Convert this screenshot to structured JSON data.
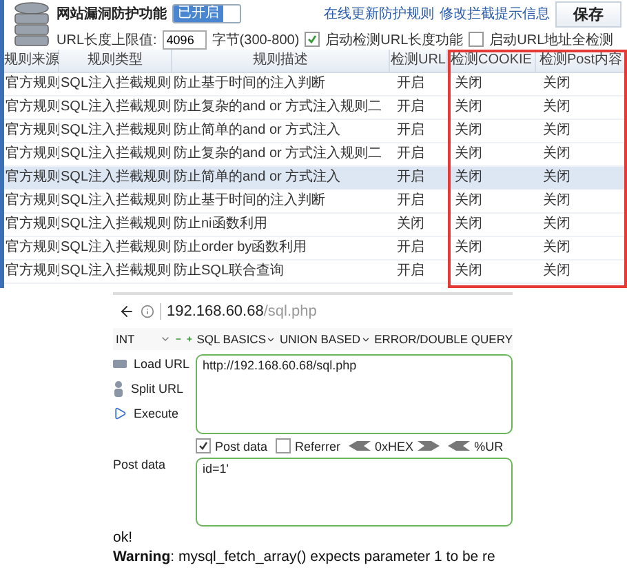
{
  "feature": {
    "title": "网站漏洞防护功能",
    "toggle": {
      "label": "已开启",
      "on": true
    }
  },
  "top_links": [
    "在线更新防护规则",
    "修改拦截提示信息"
  ],
  "save_button": "保存",
  "url_length": {
    "label": "URL长度上限值:",
    "value": "4096",
    "unit": "字节(300-800)"
  },
  "options": [
    {
      "label": "启动检测URL长度功能",
      "checked": true
    },
    {
      "label": "启动URL地址全检测",
      "checked": false
    }
  ],
  "annotation": {
    "kind": "rectangle"
  },
  "table": {
    "columns": [
      "规则来源",
      "规则类型",
      "规则描述",
      "检测URL",
      "检测COOKIE",
      "检测Post内容"
    ],
    "rows": [
      {
        "cells": [
          "官方规则",
          "SQL注入拦截规则",
          "防止基于时间的注入判断",
          "开启",
          "关闭",
          "关闭"
        ],
        "selected": false
      },
      {
        "cells": [
          "官方规则",
          "SQL注入拦截规则",
          "防止复杂的and or 方式注入规则二",
          "开启",
          "关闭",
          "关闭"
        ],
        "selected": false
      },
      {
        "cells": [
          "官方规则",
          "SQL注入拦截规则",
          "防止简单的and or 方式注入",
          "开启",
          "关闭",
          "关闭"
        ],
        "selected": false
      },
      {
        "cells": [
          "官方规则",
          "SQL注入拦截规则",
          "防止复杂的and or 方式注入规则二",
          "开启",
          "关闭",
          "关闭"
        ],
        "selected": false
      },
      {
        "cells": [
          "官方规则",
          "SQL注入拦截规则",
          "防止简单的and or 方式注入",
          "开启",
          "关闭",
          "关闭"
        ],
        "selected": true
      },
      {
        "cells": [
          "官方规则",
          "SQL注入拦截规则",
          "防止基于时间的注入判断",
          "开启",
          "关闭",
          "关闭"
        ],
        "selected": false
      },
      {
        "cells": [
          "官方规则",
          "SQL注入拦截规则",
          "防止ni函数利用",
          "关闭",
          "关闭",
          "关闭"
        ],
        "selected": false
      },
      {
        "cells": [
          "官方规则",
          "SQL注入拦截规则",
          "防止order by函数利用",
          "开启",
          "关闭",
          "关闭"
        ],
        "selected": false
      },
      {
        "cells": [
          "官方规则",
          "SQL注入拦截规则",
          "防止SQL联合查询",
          "开启",
          "关闭",
          "关闭"
        ],
        "selected": false
      }
    ]
  },
  "browser": {
    "address": {
      "host": "192.168.60.68",
      "path": "/sql.php"
    },
    "select": "INT",
    "menus": [
      {
        "label": "SQL BASICS",
        "dropdown": true
      },
      {
        "label": "UNION BASED",
        "dropdown": true
      },
      {
        "label": "ERROR/DOUBLE QUERY",
        "dropdown": false
      }
    ],
    "actions": [
      {
        "label": "Load URL",
        "kind": "load"
      },
      {
        "label": "Split URL",
        "kind": "split"
      },
      {
        "label": "Execute",
        "kind": "execute"
      }
    ],
    "url_value": "http://192.168.60.68/sql.php",
    "flags": [
      {
        "label": "Post data",
        "checked": true
      },
      {
        "label": "Referrer",
        "checked": false
      }
    ],
    "encoders": [
      {
        "label": "0xHEX",
        "kind": "both"
      },
      {
        "label": "%UR",
        "kind": "left"
      }
    ],
    "post_data": {
      "label": "Post data",
      "value": "id=1'"
    },
    "output": [
      "ok!",
      "**Warning**: mysql_fetch_array() expects parameter 1 to be re"
    ]
  }
}
